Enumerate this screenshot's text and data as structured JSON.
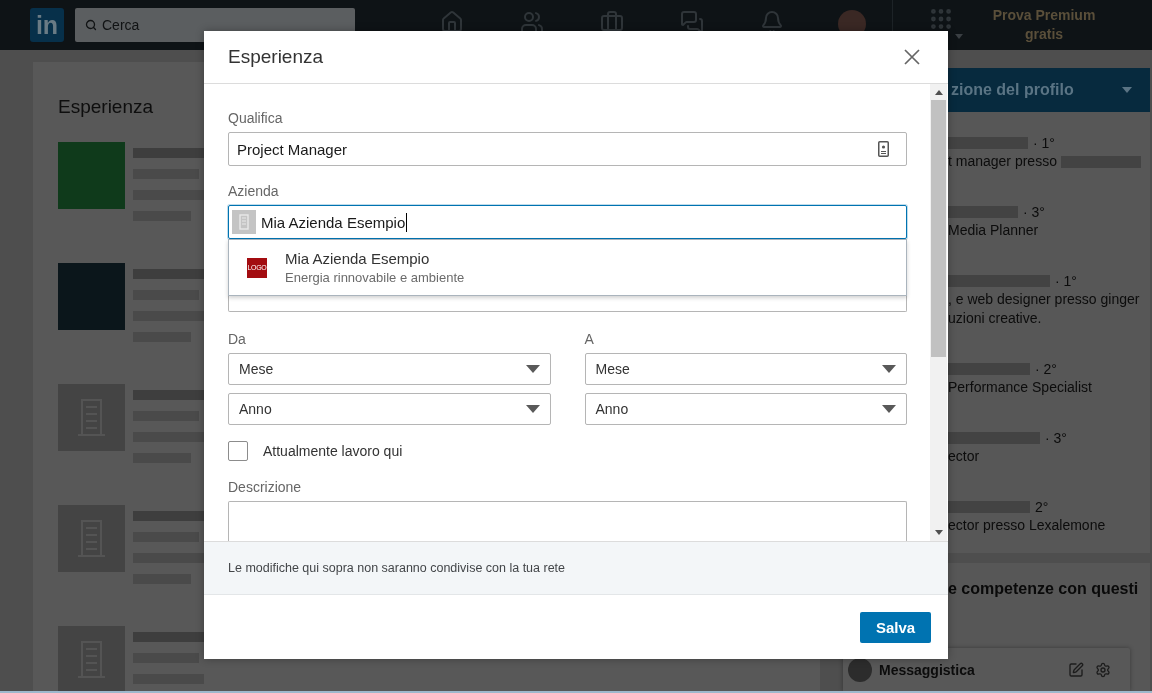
{
  "navbar": {
    "logo": "in",
    "search": {
      "placeholder": "Cerca"
    },
    "premium": "Prova Premium gratis"
  },
  "profile": {
    "heading": "Esperienza",
    "entries": [
      {
        "kind": "logo",
        "color": "#0f3a1b"
      },
      {
        "kind": "logo",
        "color": "#0b161b"
      },
      {
        "kind": "placeholder"
      },
      {
        "kind": "placeholder"
      },
      {
        "kind": "placeholder"
      }
    ]
  },
  "sidebar": {
    "banner": "zione del profilo",
    "people": [
      {
        "degree": "· 1°",
        "headline": [
          "t manager presso"
        ],
        "blurred_tail": true
      },
      {
        "degree": "· 3°",
        "headline": [
          "Media Planner"
        ],
        "blurred_tail": false
      },
      {
        "degree": "· 1°",
        "headline": [
          ", e web designer presso ginger",
          "uzioni creative."
        ],
        "blurred_tail": false
      },
      {
        "degree": "· 2°",
        "headline": [
          "Performance Specialist"
        ],
        "blurred_tail": false
      },
      {
        "degree": "· 3°",
        "headline": [
          "ector"
        ],
        "blurred_tail": false
      },
      {
        "degree": "2°",
        "headline": [
          "ector presso Lexalemone"
        ],
        "blurred_tail": false
      }
    ],
    "skills_heading": "e competenze con questi"
  },
  "messaging": {
    "title": "Messaggistica"
  },
  "modal": {
    "title": "Esperienza",
    "title_field": {
      "label": "Qualifica",
      "value": "Project Manager"
    },
    "company_field": {
      "label": "Azienda",
      "value": "Mia Azienda Esempio",
      "focused": true
    },
    "suggestions": [
      {
        "logo_text": "LOGO",
        "name": "Mia Azienda Esempio",
        "industry": "Energia rinnovabile e ambiente"
      }
    ],
    "dates": [
      {
        "label": "Da",
        "month": "Mese",
        "year": "Anno"
      },
      {
        "label": "A",
        "month": "Mese",
        "year": "Anno"
      }
    ],
    "current_job": {
      "label": "Attualmente lavoro qui",
      "checked": false
    },
    "description": {
      "label": "Descrizione"
    },
    "notice": "Le modifiche qui sopra non saranno condivise con la tua rete",
    "save_button": "Salva"
  }
}
